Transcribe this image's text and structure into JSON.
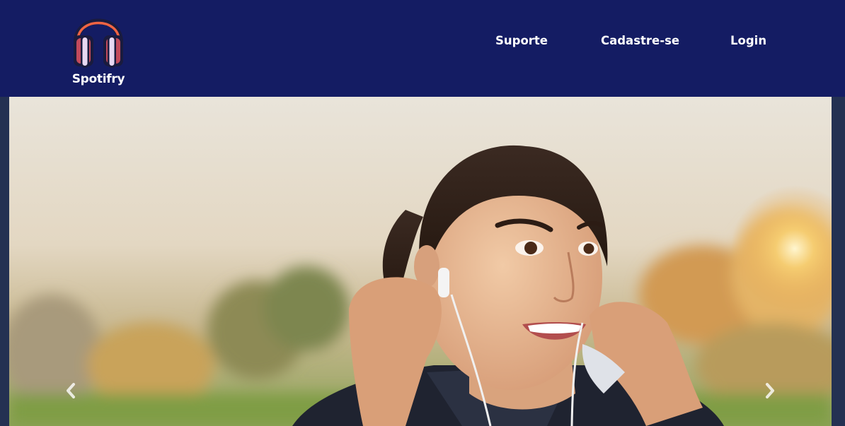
{
  "brand": {
    "name": "Spotifry",
    "logo_icon": "headphones-icon",
    "colors": {
      "nav_background": "#141c63",
      "headband": "#f06444",
      "cushion": "#e8d8f2",
      "outline": "#1a1b3e"
    }
  },
  "nav": {
    "links": [
      {
        "label": "Suporte"
      },
      {
        "label": "Cadastre-se"
      },
      {
        "label": "Login"
      }
    ]
  },
  "carousel": {
    "prev_icon": "chevron-left-icon",
    "next_icon": "chevron-right-icon"
  }
}
